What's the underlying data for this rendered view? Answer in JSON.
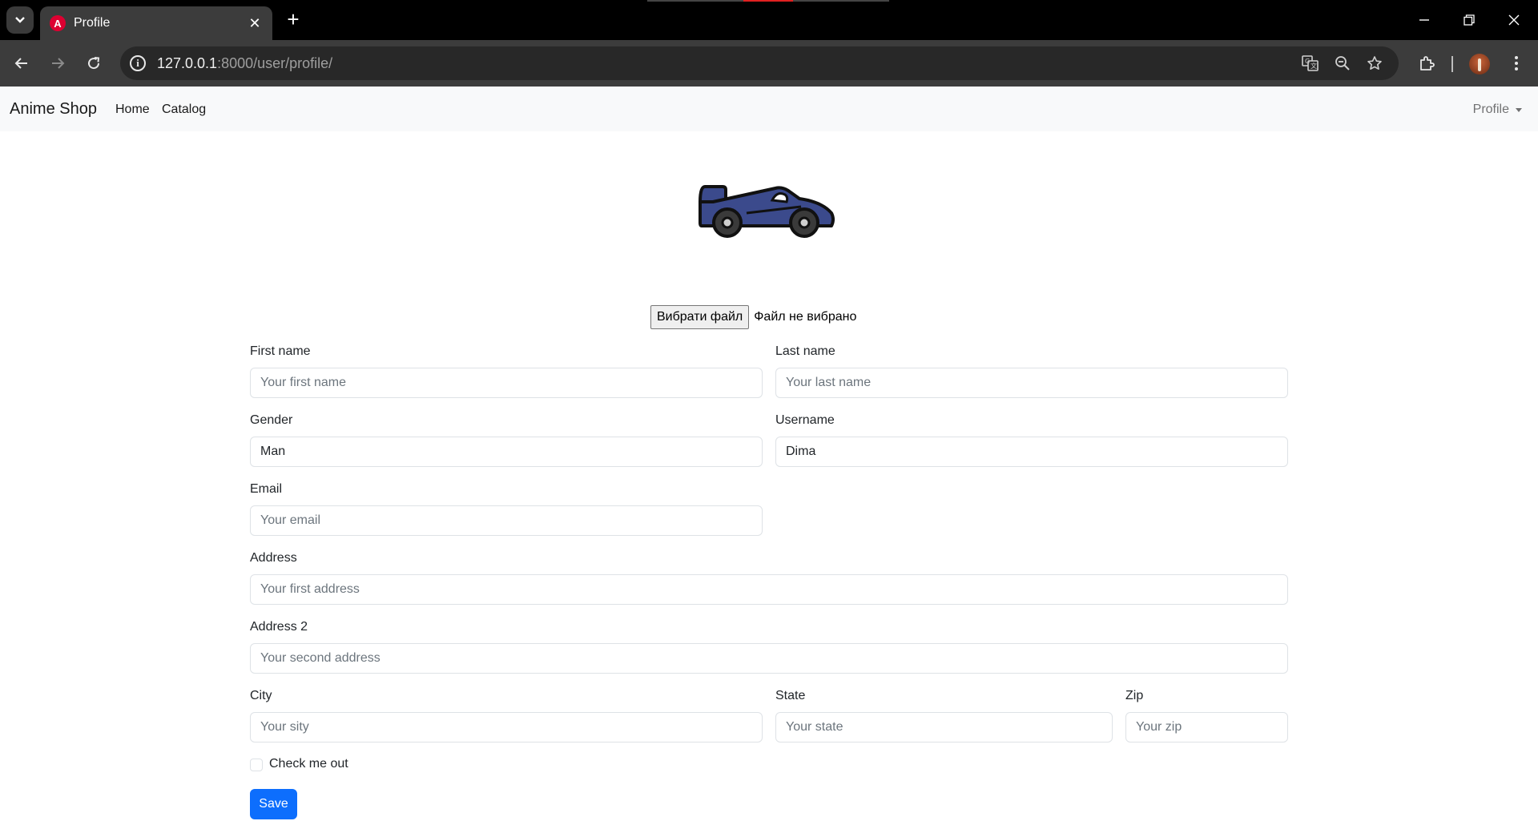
{
  "browser": {
    "tab_title": "Profile",
    "tab_favicon_letter": "A",
    "url_host": "127.0.0.1",
    "url_rest": ":8000/user/profile/",
    "icons": [
      "tab-search-icon",
      "close-icon",
      "new-tab-icon",
      "back-icon",
      "forward-icon",
      "reload-icon",
      "site-info-icon",
      "translate-icon",
      "zoom-out-icon",
      "bookmark-star-icon",
      "extensions-icon",
      "profile-avatar",
      "kebab-menu-icon",
      "minimize-icon",
      "restore-icon",
      "window-close-icon"
    ]
  },
  "navbar": {
    "brand": "Anime Shop",
    "links": [
      "Home",
      "Catalog"
    ],
    "profile": "Profile"
  },
  "upload": {
    "button": "Вибрати файл",
    "status": "Файл не вибрано"
  },
  "form": {
    "first_name": {
      "label": "First name",
      "value": "",
      "placeholder": "Your first name"
    },
    "last_name": {
      "label": "Last name",
      "value": "",
      "placeholder": "Your last name"
    },
    "gender": {
      "label": "Gender",
      "value": "Man",
      "placeholder": ""
    },
    "username": {
      "label": "Username",
      "value": "Dima",
      "placeholder": ""
    },
    "email": {
      "label": "Email",
      "value": "",
      "placeholder": "Your email"
    },
    "address": {
      "label": "Address",
      "value": "",
      "placeholder": "Your first address"
    },
    "address2": {
      "label": "Address 2",
      "value": "",
      "placeholder": "Your second address"
    },
    "city": {
      "label": "City",
      "value": "",
      "placeholder": "Your sity"
    },
    "state": {
      "label": "State",
      "value": "",
      "placeholder": "Your state"
    },
    "zip": {
      "label": "Zip",
      "value": "",
      "placeholder": "Your zip"
    },
    "check_label": "Check me out",
    "check_checked": false,
    "save": "Save"
  },
  "colors": {
    "primary": "#0d6efd",
    "navbar_bg": "#f8f9fa",
    "car_body": "#3b4a8c"
  }
}
